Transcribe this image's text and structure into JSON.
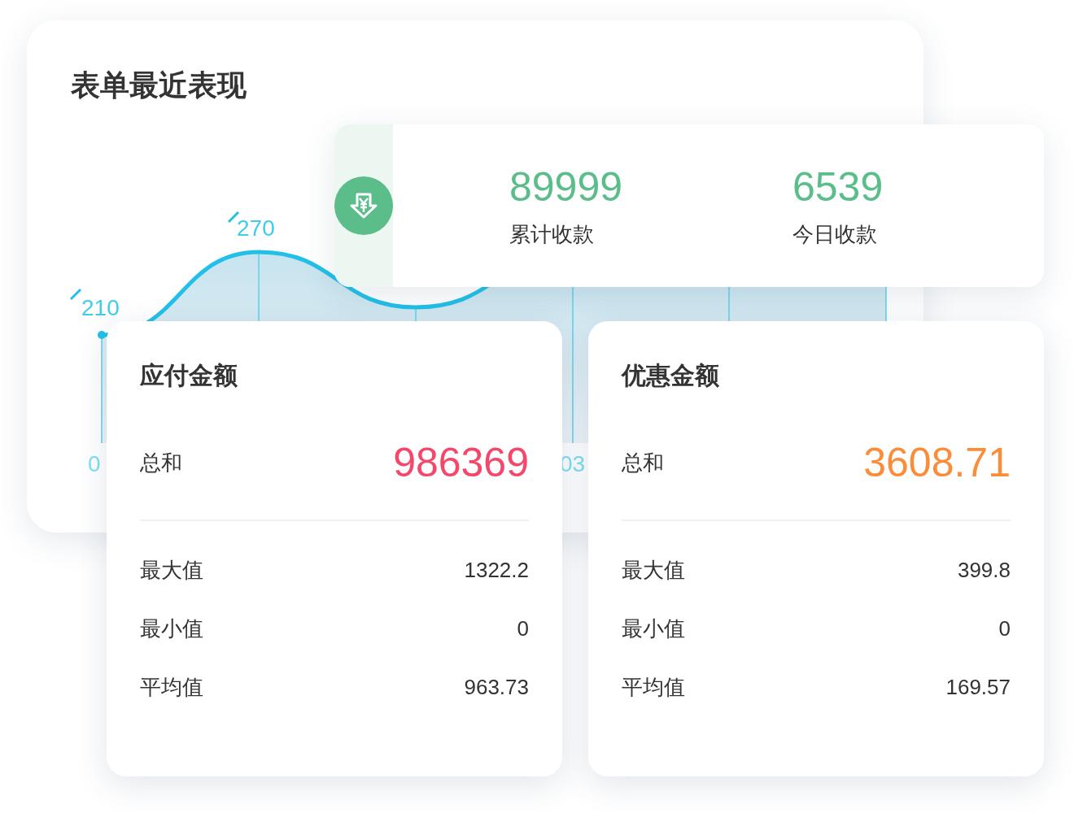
{
  "chart_card": {
    "title": "表单最近表现",
    "chart": {
      "point_labels": [
        "210",
        "270"
      ],
      "axis_labels": [
        "0",
        "03"
      ]
    }
  },
  "summary": {
    "stats": [
      {
        "value": "89999",
        "label": "累计收款"
      },
      {
        "value": "6539",
        "label": "今日收款"
      }
    ]
  },
  "amount_cards": [
    {
      "title": "应付金额",
      "total_label": "总和",
      "total": "986369",
      "color": "#f5476a",
      "rows": [
        {
          "label": "最大值",
          "value": "1322.2"
        },
        {
          "label": "最小值",
          "value": "0"
        },
        {
          "label": "平均值",
          "value": "963.73"
        }
      ]
    },
    {
      "title": "优惠金额",
      "total_label": "总和",
      "total": "3608.71",
      "color": "#fb8c3a",
      "rows": [
        {
          "label": "最大值",
          "value": "399.8"
        },
        {
          "label": "最小值",
          "value": "0"
        },
        {
          "label": "平均值",
          "value": "169.57"
        }
      ]
    }
  ]
}
